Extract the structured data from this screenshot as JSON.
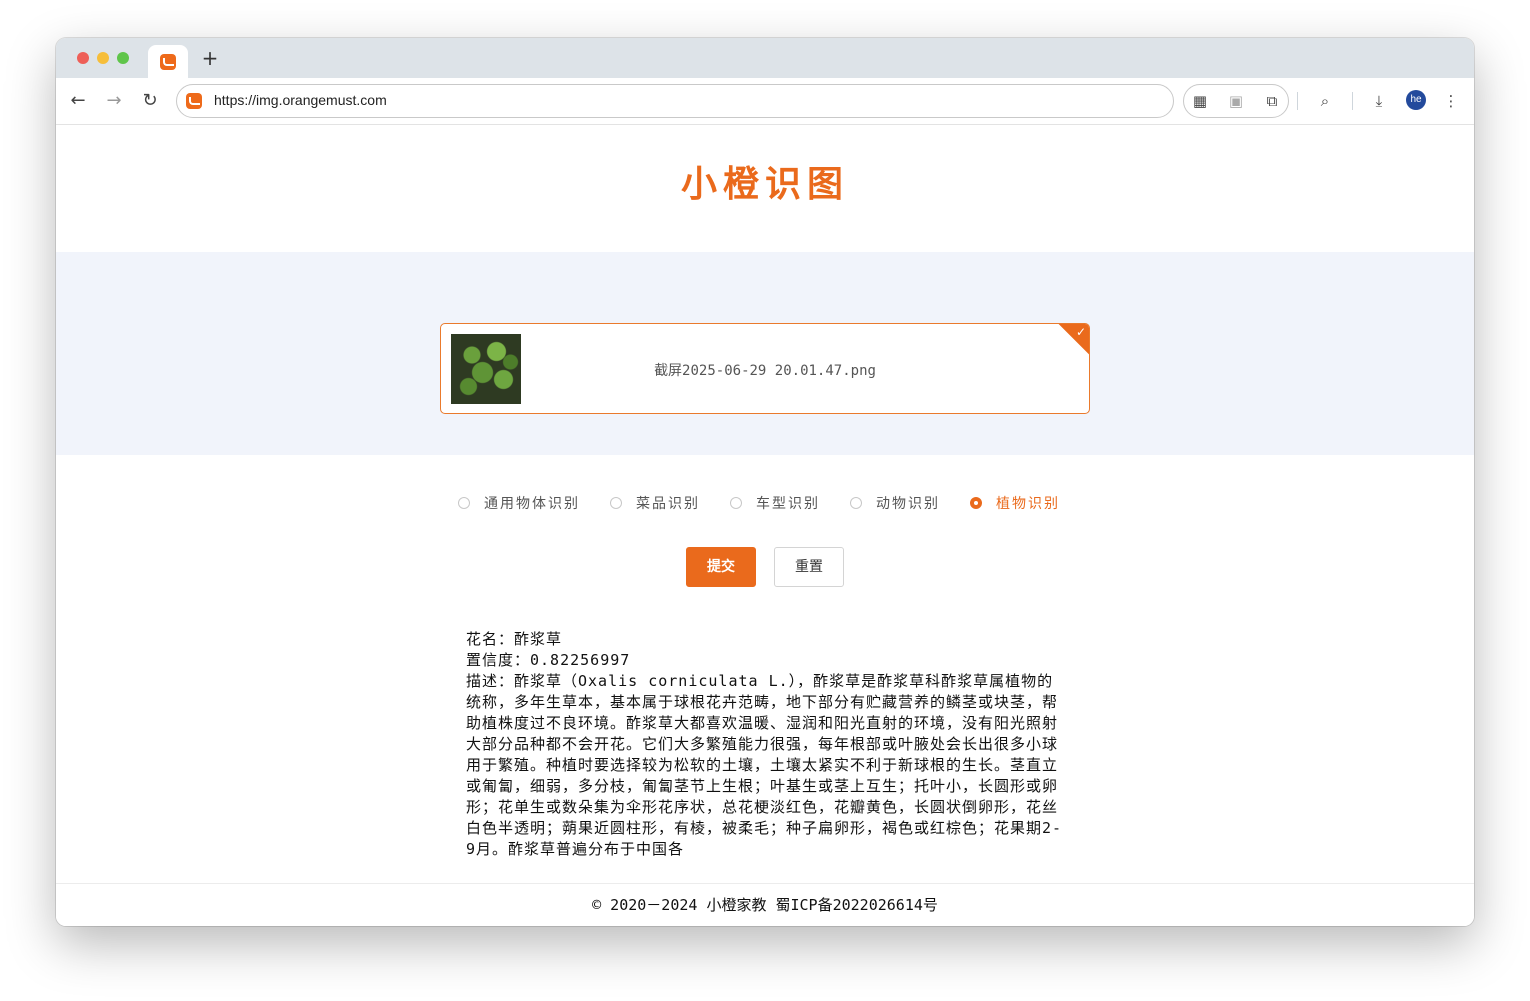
{
  "browser": {
    "url": "https://img.orangemust.com",
    "new_tab_label": "+",
    "profile_initials": "he"
  },
  "page": {
    "title": "小橙识图",
    "upload": {
      "file_name": "截屏2025-06-29 20.01.47.png"
    },
    "recognition_types": [
      {
        "label": "通用物体识别",
        "selected": false
      },
      {
        "label": "菜品识别",
        "selected": false
      },
      {
        "label": "车型识别",
        "selected": false
      },
      {
        "label": "动物识别",
        "selected": false
      },
      {
        "label": "植物识别",
        "selected": true
      }
    ],
    "buttons": {
      "submit": "提交",
      "reset": "重置"
    },
    "result": {
      "name_line": "花名：酢浆草",
      "confidence_line": "置信度：0.82256997",
      "description_line": "描述：酢浆草（Oxalis corniculata L.），酢浆草是酢浆草科酢浆草属植物的统称，多年生草本，基本属于球根花卉范畴，地下部分有贮藏营养的鳞茎或块茎，帮助植株度过不良环境。酢浆草大都喜欢温暖、湿润和阳光直射的环境，没有阳光照射大部分品种都不会开花。它们大多繁殖能力很强，每年根部或叶腋处会长出很多小球用于繁殖。种植时要选择较为松软的土壤，土壤太紧实不利于新球根的生长。茎直立或匍匐，细弱，多分枝，匍匐茎节上生根；叶基生或茎上互生；托叶小，长圆形或卵形；花单生或数朵集为伞形花序状，总花梗淡红色，花瓣黄色，长圆状倒卵形，花丝白色半透明；蒴果近圆柱形，有棱，被柔毛；种子扁卵形，褐色或红棕色；花果期2-9月。酢浆草普遍分布于中国各"
    },
    "footer": "© 2020－2024 小橙家教 蜀ICP备2022026614号"
  },
  "colors": {
    "brand_orange": "#ea6a1c",
    "upload_band": "#f1f4fb"
  }
}
